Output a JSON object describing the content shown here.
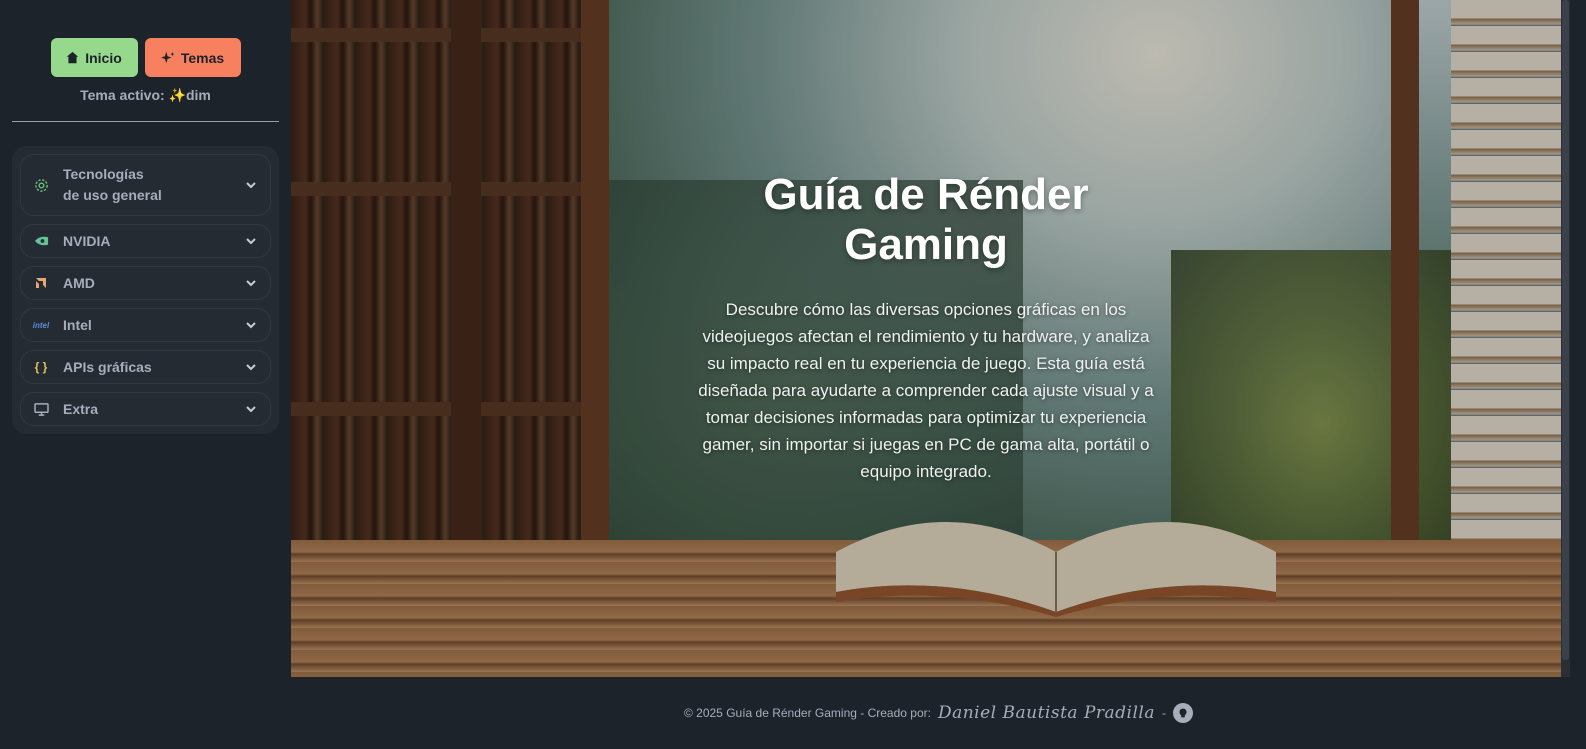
{
  "sidebar": {
    "buttons": {
      "home": "Inicio",
      "themes": "Temas"
    },
    "active_theme_label": "Tema activo:",
    "active_theme_value": "dim",
    "menu": [
      {
        "label_line1": "Tecnologías",
        "label_line2": "de uso general",
        "icon": "gear-icon",
        "icon_color": "#6bbf7a"
      },
      {
        "label": "NVIDIA",
        "icon": "nvidia-icon",
        "icon_color": "#62c39a"
      },
      {
        "label": "AMD",
        "icon": "amd-icon",
        "icon_color": "#e7a778"
      },
      {
        "label": "Intel",
        "icon": "intel-icon",
        "icon_color": "#5b8ad8"
      },
      {
        "label": "APIs gráficas",
        "icon": "braces-icon",
        "icon_color": "#e0c060"
      },
      {
        "label": "Extra",
        "icon": "monitor-icon",
        "icon_color": "#a6adbb"
      }
    ]
  },
  "hero": {
    "title": "Guía de Rénder Gaming",
    "description": "Descubre cómo las diversas opciones gráficas en los videojuegos afectan el rendimiento y tu hardware, y analiza su impacto real en tu experiencia de juego. Esta guía está diseñada para ayudarte a comprender cada ajuste visual y a tomar decisiones informadas para optimizar tu experiencia gamer, sin importar si juegas en PC de gama alta, portátil o equipo integrado."
  },
  "footer": {
    "copyright": "© 2025 Guía de Rénder Gaming - Creado por:",
    "author": "Daniel Bautista Pradilla",
    "separator": "-"
  },
  "colors": {
    "background": "#1d232a",
    "home_button": "#96d98d",
    "themes_button": "#f7805f",
    "text_muted": "#a6adbb"
  }
}
